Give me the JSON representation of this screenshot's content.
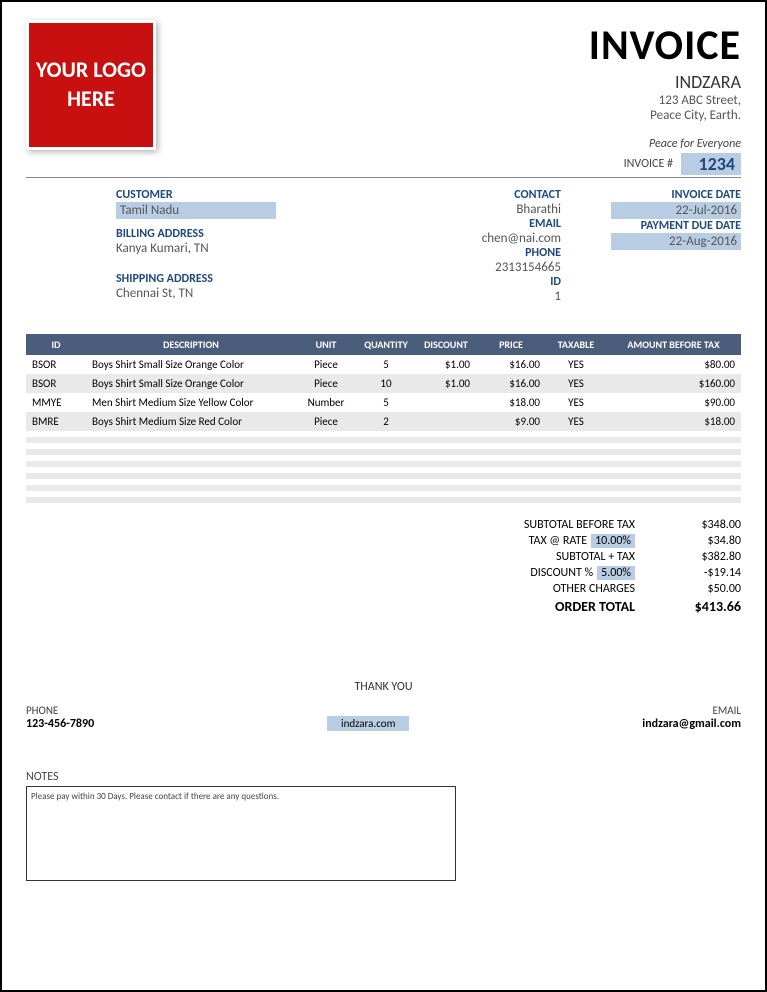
{
  "logo_text": "YOUR LOGO HERE",
  "title": "INVOICE",
  "company": {
    "name": "INDZARA",
    "addr1": "123 ABC Street,",
    "addr2": "Peace City, Earth.",
    "tagline": "Peace for Everyone"
  },
  "invoice_num_label": "INVOICE #",
  "invoice_num": "1234",
  "customer": {
    "label": "CUSTOMER",
    "name": "Tamil Nadu",
    "billing_label": "BILLING ADDRESS",
    "billing": "Kanya Kumari, TN",
    "shipping_label": "SHIPPING ADDRESS",
    "shipping": "Chennai St, TN"
  },
  "contact": {
    "contact_label": "CONTACT",
    "contact": "Bharathi",
    "email_label": "EMAIL",
    "email": "chen@nai.com",
    "phone_label": "PHONE",
    "phone": "2313154665",
    "id_label": "ID",
    "id": "1"
  },
  "dates": {
    "invoice_date_label": "INVOICE DATE",
    "invoice_date": "22-Jul-2016",
    "due_label": "PAYMENT DUE DATE",
    "due": "22-Aug-2016"
  },
  "columns": {
    "id": "ID",
    "desc": "DESCRIPTION",
    "unit": "UNIT",
    "qty": "QUANTITY",
    "disc": "DISCOUNT",
    "price": "PRICE",
    "tax": "TAXABLE",
    "amt": "AMOUNT BEFORE TAX"
  },
  "rows": [
    {
      "id": "BSOR",
      "desc": "Boys Shirt Small Size Orange Color",
      "unit": "Piece",
      "qty": "5",
      "disc": "$1.00",
      "price": "$16.00",
      "tax": "YES",
      "amt": "$80.00"
    },
    {
      "id": "BSOR",
      "desc": "Boys Shirt Small Size Orange Color",
      "unit": "Piece",
      "qty": "10",
      "disc": "$1.00",
      "price": "$16.00",
      "tax": "YES",
      "amt": "$160.00"
    },
    {
      "id": "MMYE",
      "desc": "Men Shirt Medium Size Yellow Color",
      "unit": "Number",
      "qty": "5",
      "disc": "",
      "price": "$18.00",
      "tax": "YES",
      "amt": "$90.00"
    },
    {
      "id": "BMRE",
      "desc": "Boys Shirt Medium Size Red Color",
      "unit": "Piece",
      "qty": "2",
      "disc": "",
      "price": "$9.00",
      "tax": "YES",
      "amt": "$18.00"
    }
  ],
  "totals": {
    "subtotal_label": "SUBTOTAL BEFORE TAX",
    "subtotal": "$348.00",
    "tax_label": "TAX @ RATE",
    "tax_rate": "10.00%",
    "tax_amt": "$34.80",
    "subtax_label": "SUBTOTAL + TAX",
    "subtax": "$382.80",
    "disc_label": "DISCOUNT %",
    "disc_rate": "5.00%",
    "disc_amt": "-$19.14",
    "other_label": "OTHER CHARGES",
    "other": "$50.00",
    "total_label": "ORDER TOTAL",
    "total": "$413.66"
  },
  "notes_label": "NOTES",
  "notes": "Please pay within 30 Days. Please contact if there are any questions.",
  "thankyou": "THANK YOU",
  "footer": {
    "phone_label": "PHONE",
    "phone": "123-456-7890",
    "site": "indzara.com",
    "email_label": "EMAIL",
    "email": "indzara@gmail.com"
  }
}
